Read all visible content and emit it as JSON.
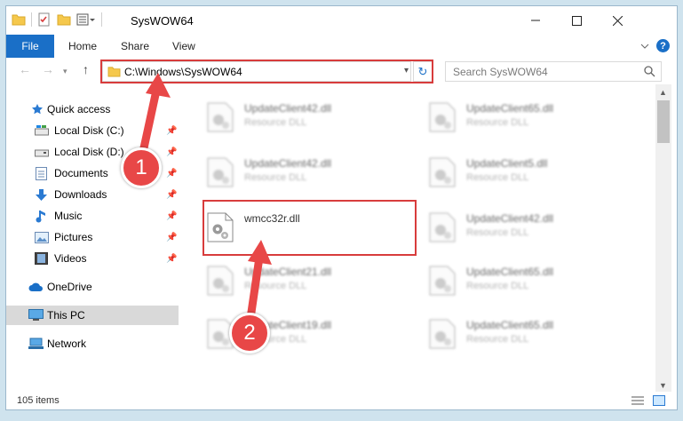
{
  "window": {
    "title": "SysWOW64"
  },
  "ribbon": {
    "file_tab": "File",
    "tabs": [
      "Home",
      "Share",
      "View"
    ]
  },
  "address": {
    "path": "C:\\Windows\\SysWOW64"
  },
  "search": {
    "placeholder": "Search SysWOW64"
  },
  "sidebar": {
    "quick_access": "Quick access",
    "items": [
      {
        "label": "Local Disk (C:)",
        "icon": "drive-icon"
      },
      {
        "label": "Local Disk (D:)",
        "icon": "drive-icon"
      },
      {
        "label": "Documents",
        "icon": "documents-icon"
      },
      {
        "label": "Downloads",
        "icon": "downloads-icon"
      },
      {
        "label": "Music",
        "icon": "music-icon"
      },
      {
        "label": "Pictures",
        "icon": "pictures-icon"
      },
      {
        "label": "Videos",
        "icon": "videos-icon"
      }
    ],
    "onedrive": "OneDrive",
    "this_pc": "This PC",
    "network": "Network"
  },
  "files": {
    "left": [
      {
        "name": "UpdateClient42.dll",
        "type": "Resource DLL"
      },
      {
        "name": "UpdateClient42.dll",
        "type": "Resource DLL"
      },
      {
        "name": "wmcc32r.dll",
        "type": ""
      },
      {
        "name": "UpdateClient21.dll",
        "type": "Resource DLL"
      },
      {
        "name": "UpdateClient19.dll",
        "type": "Resource DLL"
      }
    ],
    "right": [
      {
        "name": "UpdateClient65.dll",
        "type": "Resource DLL"
      },
      {
        "name": "UpdateClient5.dll",
        "type": "Resource DLL"
      },
      {
        "name": "UpdateClient42.dll",
        "type": "Resource DLL"
      },
      {
        "name": "UpdateClient65.dll",
        "type": "Resource DLL"
      },
      {
        "name": "UpdateClient65.dll",
        "type": "Resource DLL"
      }
    ]
  },
  "status": {
    "item_count": "105 items"
  },
  "annotations": {
    "step1": "1",
    "step2": "2"
  },
  "colors": {
    "accent": "#1a6fc7",
    "annotation_red": "#e84747",
    "highlight": "#cde8ff"
  }
}
